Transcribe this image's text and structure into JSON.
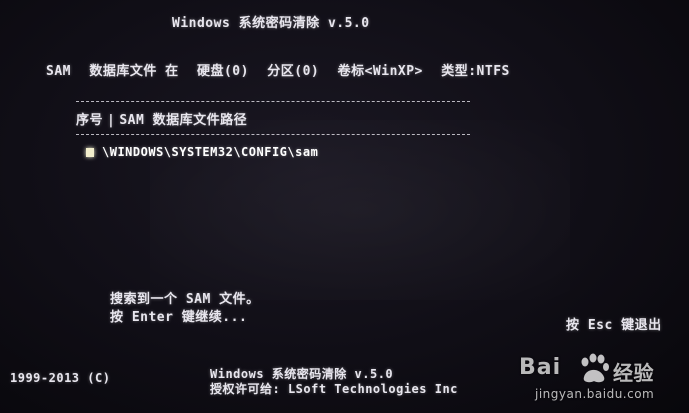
{
  "title": "Windows 系统密码清除 v.5.0",
  "info": {
    "sam_label": "SAM",
    "db_label": "数据库文件 在",
    "disk": "硬盘(0)",
    "partition": "分区(0)",
    "volume": "卷标<WinXP>",
    "type": "类型:NTFS"
  },
  "table": {
    "col_index": "序号",
    "col_sep": "|",
    "col_path": "SAM 数据库文件路径",
    "rows": [
      {
        "path": "\\WINDOWS\\SYSTEM32\\CONFIG\\sam"
      }
    ]
  },
  "messages": {
    "found": "搜索到一个 SAM 文件。",
    "continue": "按 Enter 键继续...",
    "esc": "按 Esc 键退出"
  },
  "footer": {
    "copyright": "1999-2013 (C)",
    "product": "Windows 系统密码清除 v.5.0",
    "license": "授权许可给: LSoft Technologies Inc"
  },
  "watermark": {
    "brand": "Bai",
    "brand_suffix": "经验",
    "url": "jingyan.baidu.com",
    "icon": "baidu-paw-icon"
  }
}
